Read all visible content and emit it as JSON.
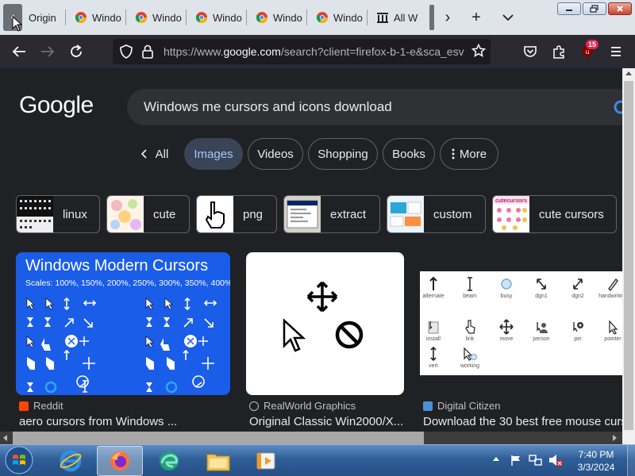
{
  "browser": {
    "tabs": [
      {
        "label": "Origin"
      },
      {
        "label": "Windo"
      },
      {
        "label": "Windo"
      },
      {
        "label": "Windo"
      },
      {
        "label": "Windo"
      },
      {
        "label": "Windo"
      },
      {
        "label": "All W"
      }
    ],
    "url_prefix": "https://www.",
    "url_domain": "google.com",
    "url_suffix": "/search?client=firefox-b-1-e&sca_esv",
    "notification_count": "15"
  },
  "google": {
    "logo": "Google",
    "query": "Windows me cursors and icons download",
    "chips": [
      {
        "label": "All"
      },
      {
        "label": "Images"
      },
      {
        "label": "Videos"
      },
      {
        "label": "Shopping"
      },
      {
        "label": "Books"
      },
      {
        "label": "More"
      }
    ],
    "refinements": [
      {
        "label": "linux"
      },
      {
        "label": "cute"
      },
      {
        "label": "png"
      },
      {
        "label": "extract"
      },
      {
        "label": "custom"
      },
      {
        "label": "cute cursors"
      }
    ],
    "results": [
      {
        "image_title": "Windows Modern Cursors",
        "image_subtitle": "Scales: 100%, 150%, 200%, 250%, 300%, 350%, 400%",
        "source": "Reddit",
        "title": "aero cursors from Windows ..."
      },
      {
        "source": "RealWorld Graphics",
        "title": "Original Classic Win2000/X..."
      },
      {
        "image_labels": [
          "alternate",
          "beam",
          "busy",
          "dgn1",
          "dgn2",
          "handwriting",
          "install",
          "link",
          "move",
          "person",
          "pin",
          "pointer",
          "vert",
          "working"
        ],
        "source": "Digital Citizen",
        "title": "Download the 30 best free mouse curs"
      }
    ],
    "refine_thumb_text": "cutecursors"
  },
  "taskbar": {
    "time": "7:40 PM",
    "date": "3/3/2024"
  },
  "colors": {
    "page_bg": "#202124",
    "accent": "#a8c7fa",
    "card_blue": "#1a5de8"
  }
}
